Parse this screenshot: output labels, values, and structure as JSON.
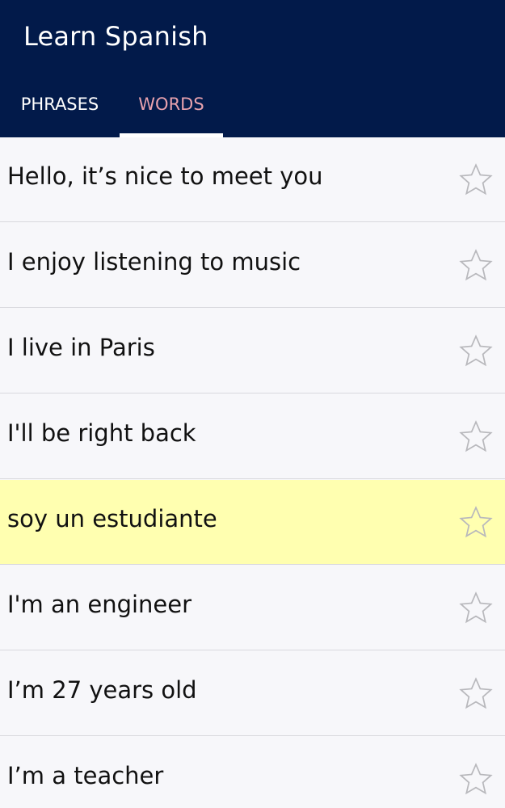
{
  "app_bar": {
    "title": "Learn Spanish",
    "background_color": "#021a4a"
  },
  "tabs": [
    {
      "label": "PHRASES",
      "selected": false
    },
    {
      "label": "WORDS",
      "selected": true
    }
  ],
  "colors": {
    "selected_tab_text": "#e8a2ae",
    "highlight_row": "#ffffb0",
    "star_outline": "#b8b8bc"
  },
  "list": {
    "items": [
      {
        "text": "Hello, it’s nice to meet you",
        "icon": "star-outline-icon",
        "starred": false
      },
      {
        "text": "I enjoy listening to music",
        "icon": "star-outline-icon",
        "starred": false
      },
      {
        "text": "I live in Paris",
        "icon": "star-outline-icon",
        "starred": false
      },
      {
        "text": "I'll be right back",
        "icon": "star-outline-icon",
        "starred": false
      },
      {
        "text": "soy un estudiante",
        "icon": "star-outline-icon",
        "starred": false,
        "highlighted": true
      },
      {
        "text": "I'm an engineer",
        "icon": "star-outline-icon",
        "starred": false
      },
      {
        "text": "I’m 27 years old",
        "icon": "star-outline-icon",
        "starred": false
      },
      {
        "text": "I’m a teacher",
        "icon": "star-outline-icon",
        "starred": false
      }
    ]
  }
}
